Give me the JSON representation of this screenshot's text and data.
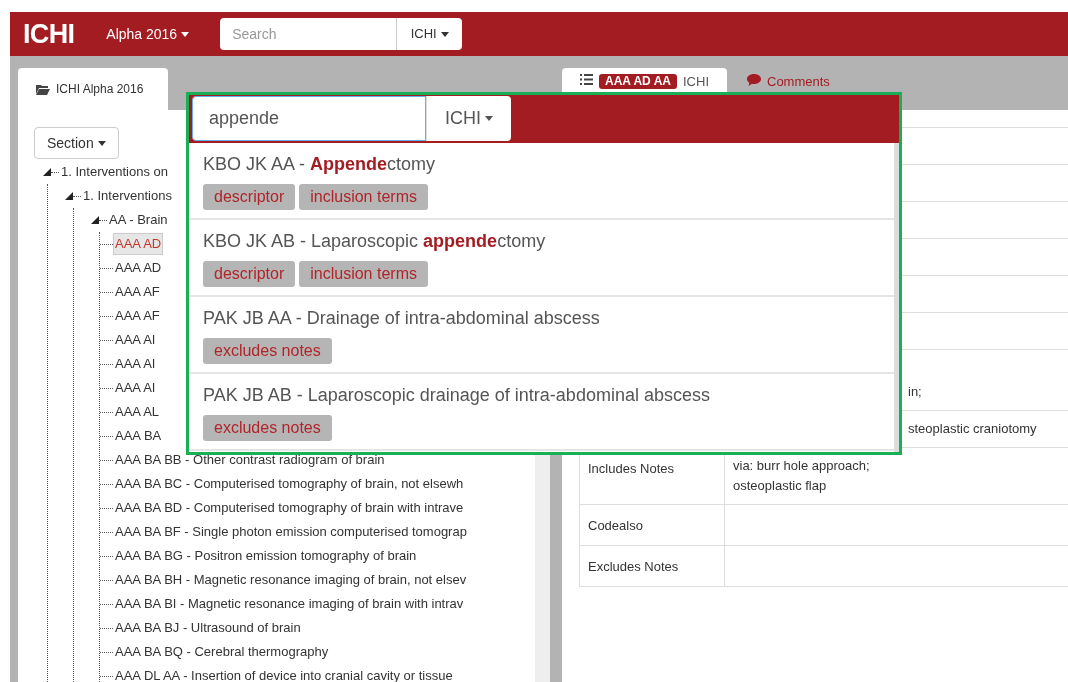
{
  "navbar": {
    "brand": "ICHI",
    "version_menu": "Alpha 2016",
    "search": {
      "placeholder": "Search",
      "scope": "ICHI"
    }
  },
  "left_panel": {
    "tab": {
      "label": "ICHI Alpha 2016",
      "selected": true
    },
    "section_button": "Section",
    "tree": [
      {
        "label": "1. Interventions on",
        "selected": false,
        "expanded": true,
        "children": [
          {
            "label": "1. Interventions",
            "selected": false,
            "expanded": true,
            "children": [
              {
                "label": "AA - Brain",
                "selected": false,
                "expanded": true,
                "children": [
                  {
                    "label": "AAA AD",
                    "selected": true
                  },
                  {
                    "label": "AAA AD",
                    "selected": false
                  },
                  {
                    "label": "AAA AF",
                    "selected": false
                  },
                  {
                    "label": "AAA AF",
                    "selected": false
                  },
                  {
                    "label": "AAA AI",
                    "selected": false
                  },
                  {
                    "label": "AAA AI",
                    "selected": false
                  },
                  {
                    "label": "AAA AI",
                    "selected": false
                  },
                  {
                    "label": "AAA AL",
                    "selected": false
                  },
                  {
                    "label": "AAA BA",
                    "selected": false
                  },
                  {
                    "label": "AAA BA BB - Other contrast radiogram of brain",
                    "selected": false
                  },
                  {
                    "label": "AAA BA BC - Computerised tomography of brain, not elsewh",
                    "selected": false
                  },
                  {
                    "label": "AAA BA BD - Computerised tomography of brain with intrave",
                    "selected": false
                  },
                  {
                    "label": "AAA BA BF - Single photon emission computerised tomograp",
                    "selected": false
                  },
                  {
                    "label": "AAA BA BG - Positron emission tomography of brain",
                    "selected": false
                  },
                  {
                    "label": "AAA BA BH - Magnetic resonance imaging of brain, not elsev",
                    "selected": false
                  },
                  {
                    "label": "AAA BA BI - Magnetic resonance imaging of brain with intrav",
                    "selected": false
                  },
                  {
                    "label": "AAA BA BJ - Ultrasound of brain",
                    "selected": false
                  },
                  {
                    "label": "AAA BA BQ - Cerebral thermography",
                    "selected": false
                  },
                  {
                    "label": "AAA DL AA - Insertion of device into cranial cavity or tissue",
                    "selected": false
                  }
                ]
              }
            ]
          }
        ]
      }
    ]
  },
  "right_panel": {
    "tabs": [
      {
        "badge": "AAA AD AA",
        "label": "ICHI",
        "selected": true
      },
      {
        "label": "Comments",
        "selected": false
      }
    ],
    "rows": [
      {
        "kind": "covered",
        "value": "in;"
      },
      {
        "kind": "covered",
        "value": "steoplastic craniotomy"
      },
      {
        "kind": "field",
        "label": "Includes Notes",
        "value": "via: burr hole approach;\nosteoplastic flap"
      },
      {
        "kind": "field",
        "label": "Codealso"
      },
      {
        "kind": "field",
        "label": "Excludes Notes"
      }
    ]
  },
  "search_popup": {
    "query": "appende",
    "scope": "ICHI",
    "results": [
      {
        "title": "KBO JK AA - **Appende**ctomy",
        "tags": [
          "descriptor",
          "inclusion terms"
        ]
      },
      {
        "title": "KBO JK AB - Laparoscopic **appende**ctomy",
        "tags": [
          "descriptor",
          "inclusion terms"
        ]
      },
      {
        "title": "PAK JB AA - Drainage of intra-abdominal abscess",
        "tags": [
          "excludes notes"
        ]
      },
      {
        "title": "PAK JB AB - Laparoscopic drainage of intra-abdominal abscess",
        "tags": [
          "excludes notes"
        ]
      }
    ]
  }
}
